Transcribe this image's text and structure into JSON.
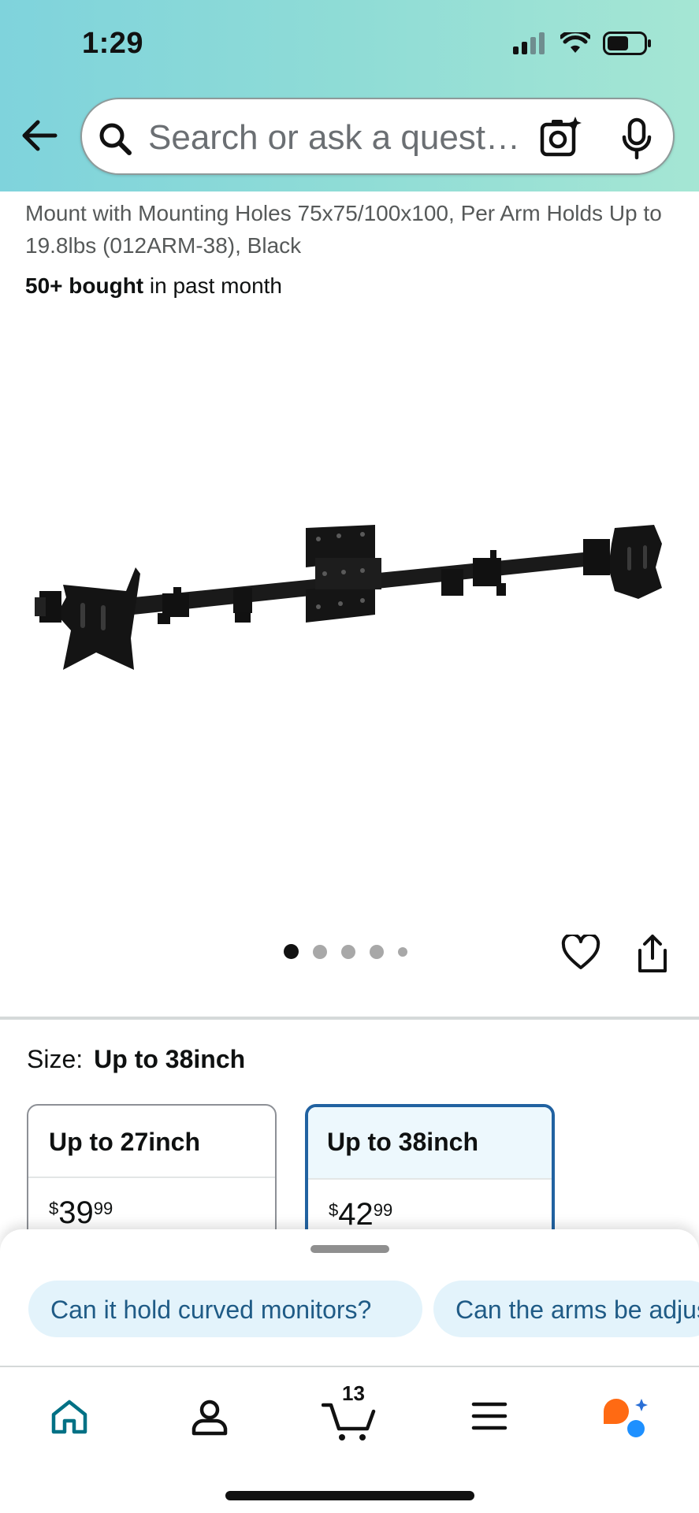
{
  "status_bar": {
    "time": "1:29"
  },
  "search": {
    "placeholder": "Search or ask a question"
  },
  "product": {
    "title_visible": "Mount with Mounting Holes 75x75/100x100, Per Arm Holds Up to 19.8lbs (012ARM-38), Black",
    "bought_bold": "50+ bought",
    "bought_rest": " in past month",
    "image_count": 5,
    "image_index": 1
  },
  "size": {
    "label": "Size:",
    "selected": "Up to 38inch",
    "options": [
      {
        "name": "Up to 27inch",
        "currency": "$",
        "dollars": "39",
        "cents": "99"
      },
      {
        "name": "Up to 38inch",
        "currency": "$",
        "dollars": "42",
        "cents": "99"
      }
    ]
  },
  "suggestions": [
    "Can it hold curved monitors?",
    "Can the arms be adjusted?"
  ],
  "nav": {
    "cart_count": "13",
    "items": [
      "home-icon",
      "account-icon",
      "cart-icon",
      "menu-icon",
      "rufus-icon"
    ]
  },
  "colors": {
    "accent_blue": "#2162a1",
    "home_teal": "#007185",
    "chip_bg": "#e3f3fb",
    "rufus_orange": "#ff6a13",
    "rufus_blue": "#1e90ff"
  }
}
